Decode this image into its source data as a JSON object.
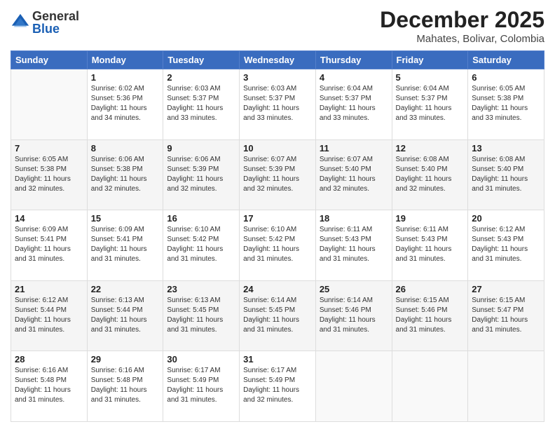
{
  "header": {
    "logo_general": "General",
    "logo_blue": "Blue",
    "month_title": "December 2025",
    "location": "Mahates, Bolivar, Colombia"
  },
  "days_of_week": [
    "Sunday",
    "Monday",
    "Tuesday",
    "Wednesday",
    "Thursday",
    "Friday",
    "Saturday"
  ],
  "weeks": [
    [
      {
        "day": "",
        "info": ""
      },
      {
        "day": "1",
        "info": "Sunrise: 6:02 AM\nSunset: 5:36 PM\nDaylight: 11 hours\nand 34 minutes."
      },
      {
        "day": "2",
        "info": "Sunrise: 6:03 AM\nSunset: 5:37 PM\nDaylight: 11 hours\nand 33 minutes."
      },
      {
        "day": "3",
        "info": "Sunrise: 6:03 AM\nSunset: 5:37 PM\nDaylight: 11 hours\nand 33 minutes."
      },
      {
        "day": "4",
        "info": "Sunrise: 6:04 AM\nSunset: 5:37 PM\nDaylight: 11 hours\nand 33 minutes."
      },
      {
        "day": "5",
        "info": "Sunrise: 6:04 AM\nSunset: 5:37 PM\nDaylight: 11 hours\nand 33 minutes."
      },
      {
        "day": "6",
        "info": "Sunrise: 6:05 AM\nSunset: 5:38 PM\nDaylight: 11 hours\nand 33 minutes."
      }
    ],
    [
      {
        "day": "7",
        "info": "Sunrise: 6:05 AM\nSunset: 5:38 PM\nDaylight: 11 hours\nand 32 minutes."
      },
      {
        "day": "8",
        "info": "Sunrise: 6:06 AM\nSunset: 5:38 PM\nDaylight: 11 hours\nand 32 minutes."
      },
      {
        "day": "9",
        "info": "Sunrise: 6:06 AM\nSunset: 5:39 PM\nDaylight: 11 hours\nand 32 minutes."
      },
      {
        "day": "10",
        "info": "Sunrise: 6:07 AM\nSunset: 5:39 PM\nDaylight: 11 hours\nand 32 minutes."
      },
      {
        "day": "11",
        "info": "Sunrise: 6:07 AM\nSunset: 5:40 PM\nDaylight: 11 hours\nand 32 minutes."
      },
      {
        "day": "12",
        "info": "Sunrise: 6:08 AM\nSunset: 5:40 PM\nDaylight: 11 hours\nand 32 minutes."
      },
      {
        "day": "13",
        "info": "Sunrise: 6:08 AM\nSunset: 5:40 PM\nDaylight: 11 hours\nand 31 minutes."
      }
    ],
    [
      {
        "day": "14",
        "info": "Sunrise: 6:09 AM\nSunset: 5:41 PM\nDaylight: 11 hours\nand 31 minutes."
      },
      {
        "day": "15",
        "info": "Sunrise: 6:09 AM\nSunset: 5:41 PM\nDaylight: 11 hours\nand 31 minutes."
      },
      {
        "day": "16",
        "info": "Sunrise: 6:10 AM\nSunset: 5:42 PM\nDaylight: 11 hours\nand 31 minutes."
      },
      {
        "day": "17",
        "info": "Sunrise: 6:10 AM\nSunset: 5:42 PM\nDaylight: 11 hours\nand 31 minutes."
      },
      {
        "day": "18",
        "info": "Sunrise: 6:11 AM\nSunset: 5:43 PM\nDaylight: 11 hours\nand 31 minutes."
      },
      {
        "day": "19",
        "info": "Sunrise: 6:11 AM\nSunset: 5:43 PM\nDaylight: 11 hours\nand 31 minutes."
      },
      {
        "day": "20",
        "info": "Sunrise: 6:12 AM\nSunset: 5:43 PM\nDaylight: 11 hours\nand 31 minutes."
      }
    ],
    [
      {
        "day": "21",
        "info": "Sunrise: 6:12 AM\nSunset: 5:44 PM\nDaylight: 11 hours\nand 31 minutes."
      },
      {
        "day": "22",
        "info": "Sunrise: 6:13 AM\nSunset: 5:44 PM\nDaylight: 11 hours\nand 31 minutes."
      },
      {
        "day": "23",
        "info": "Sunrise: 6:13 AM\nSunset: 5:45 PM\nDaylight: 11 hours\nand 31 minutes."
      },
      {
        "day": "24",
        "info": "Sunrise: 6:14 AM\nSunset: 5:45 PM\nDaylight: 11 hours\nand 31 minutes."
      },
      {
        "day": "25",
        "info": "Sunrise: 6:14 AM\nSunset: 5:46 PM\nDaylight: 11 hours\nand 31 minutes."
      },
      {
        "day": "26",
        "info": "Sunrise: 6:15 AM\nSunset: 5:46 PM\nDaylight: 11 hours\nand 31 minutes."
      },
      {
        "day": "27",
        "info": "Sunrise: 6:15 AM\nSunset: 5:47 PM\nDaylight: 11 hours\nand 31 minutes."
      }
    ],
    [
      {
        "day": "28",
        "info": "Sunrise: 6:16 AM\nSunset: 5:48 PM\nDaylight: 11 hours\nand 31 minutes."
      },
      {
        "day": "29",
        "info": "Sunrise: 6:16 AM\nSunset: 5:48 PM\nDaylight: 11 hours\nand 31 minutes."
      },
      {
        "day": "30",
        "info": "Sunrise: 6:17 AM\nSunset: 5:49 PM\nDaylight: 11 hours\nand 31 minutes."
      },
      {
        "day": "31",
        "info": "Sunrise: 6:17 AM\nSunset: 5:49 PM\nDaylight: 11 hours\nand 32 minutes."
      },
      {
        "day": "",
        "info": ""
      },
      {
        "day": "",
        "info": ""
      },
      {
        "day": "",
        "info": ""
      }
    ]
  ]
}
